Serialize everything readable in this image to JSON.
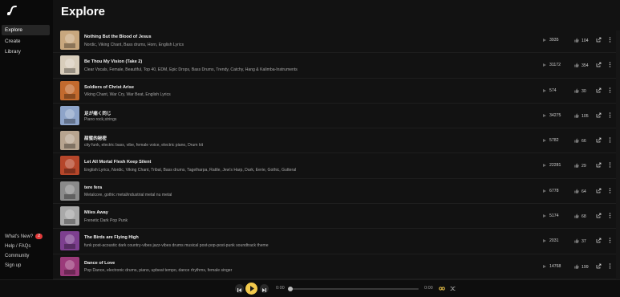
{
  "page": {
    "title": "Explore"
  },
  "sidebar": {
    "nav": [
      {
        "label": "Explore",
        "active": true
      },
      {
        "label": "Create",
        "active": false
      },
      {
        "label": "Library",
        "active": false
      }
    ],
    "bottom": [
      {
        "label": "What's New?",
        "badge": "2"
      },
      {
        "label": "Help / FAQs"
      },
      {
        "label": "Community"
      },
      {
        "label": "Sign up"
      }
    ]
  },
  "tracks": [
    {
      "title": "Nothing But the Blood of Jesus",
      "tags": "Nordic, Viking Chant, Bass drums, Horn, English Lyrics",
      "plays": "3935",
      "likes": "104",
      "thumb_color": "#c8a77e"
    },
    {
      "title": "Be Thou My Vision (Take 2)",
      "tags": "Clear Vocals, Female, Beautiful, Top 40, EDM, Epic Drops, Bass Drums, Trendy, Catchy, Hang & Kalimba-Instruments",
      "plays": "31172",
      "likes": "354",
      "thumb_color": "#d8cdbb"
    },
    {
      "title": "Soldiers of Christ Arise",
      "tags": "Viking Chant, War Cry, War Beat, English Lyrics",
      "plays": "574",
      "likes": "30",
      "thumb_color": "#c26a2e"
    },
    {
      "title": "足が痛く同じ",
      "tags": "Piano rock,strings",
      "plays": "34275",
      "likes": "105",
      "thumb_color": "#8ea4c9"
    },
    {
      "title": "甜蜜的秘密",
      "tags": "city funk, electric bass, vibe, female voice, electric piano, Drum kit",
      "plays": "5782",
      "likes": "66",
      "thumb_color": "#b7a48f"
    },
    {
      "title": "Let All Mortal Flesh Keep Silent",
      "tags": "English Lyrics, Nordic, Viking Chant, Tribal, Bass drums, Tagelharpa, Rattle, Jew's Harp, Dark, Eerie, Gothic, Gutteral",
      "plays": "22281",
      "likes": "29",
      "thumb_color": "#b5462a"
    },
    {
      "title": "tere fera",
      "tags": "Metalcore, gothic metal/industrial metal nu metal",
      "plays": "6778",
      "likes": "64",
      "thumb_color": "#8a8a8a"
    },
    {
      "title": "Miles Away",
      "tags": "Frenetic Dark Pop Punk",
      "plays": "5174",
      "likes": "68",
      "thumb_color": "#a9a9a9"
    },
    {
      "title": "The Birds are Flying High",
      "tags": "funk post-acoustic dark country-vibes jazz-vibes drums musical post-pop-post-punk soundtrack theme",
      "plays": "2031",
      "likes": "37",
      "thumb_color": "#7d3f8f"
    },
    {
      "title": "Dance of Love",
      "tags": "Pop Dance, electronic drums, piano, upbeat tempo, dance rhythms, female singer",
      "plays": "14768",
      "likes": "199",
      "thumb_color": "#9b3a7a"
    }
  ],
  "player": {
    "current_time": "0:00",
    "duration": "0:00",
    "progress": 0
  },
  "colors": {
    "accent": "#f2c94c",
    "badge": "#e23b3b"
  }
}
